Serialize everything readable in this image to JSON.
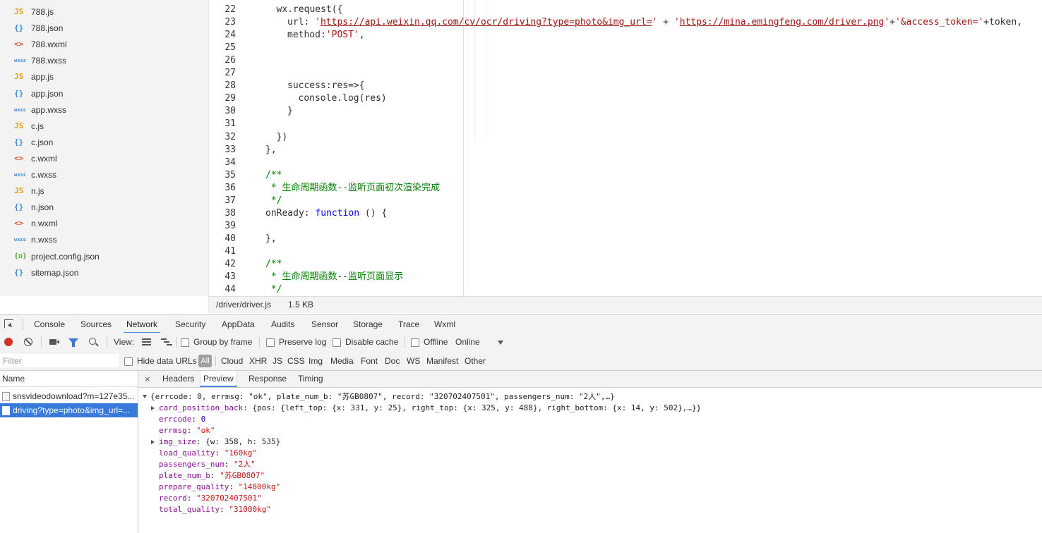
{
  "file_tree": [
    {
      "icon": "js",
      "glyph": "JS",
      "name": "788.js"
    },
    {
      "icon": "json",
      "glyph": "{}",
      "name": "788.json"
    },
    {
      "icon": "wxml",
      "glyph": "<>",
      "name": "788.wxml"
    },
    {
      "icon": "wxss",
      "glyph": "wxss",
      "name": "788.wxss"
    },
    {
      "icon": "js",
      "glyph": "JS",
      "name": "app.js"
    },
    {
      "icon": "json",
      "glyph": "{}",
      "name": "app.json"
    },
    {
      "icon": "wxss",
      "glyph": "wxss",
      "name": "app.wxss"
    },
    {
      "icon": "js",
      "glyph": "JS",
      "name": "c.js"
    },
    {
      "icon": "json",
      "glyph": "{}",
      "name": "c.json"
    },
    {
      "icon": "wxml",
      "glyph": "<>",
      "name": "c.wxml"
    },
    {
      "icon": "wxss",
      "glyph": "wxss",
      "name": "c.wxss"
    },
    {
      "icon": "js",
      "glyph": "JS",
      "name": "n.js"
    },
    {
      "icon": "json",
      "glyph": "{}",
      "name": "n.json"
    },
    {
      "icon": "wxml",
      "glyph": "<>",
      "name": "n.wxml"
    },
    {
      "icon": "wxss",
      "glyph": "wxss",
      "name": "n.wxss"
    },
    {
      "icon": "config",
      "glyph": "{o}",
      "name": "project.config.json"
    },
    {
      "icon": "json",
      "glyph": "{}",
      "name": "sitemap.json"
    }
  ],
  "editor": {
    "lines": [
      {
        "n": "22",
        "indent": 1,
        "parts": [
          [
            "",
            "wx.request({"
          ]
        ]
      },
      {
        "n": "23",
        "indent": 2,
        "parts": [
          [
            "",
            "url: "
          ],
          [
            "str",
            "'"
          ],
          [
            "url",
            "https://api.weixin.qq.com/cv/ocr/driving?type=photo&img_url="
          ],
          [
            "str",
            "'"
          ],
          [
            "",
            " + "
          ],
          [
            "str",
            "'"
          ],
          [
            "url",
            "https://mina.emingfeng.com/driver.png"
          ],
          [
            "str",
            "'"
          ],
          [
            "",
            "+"
          ],
          [
            "str",
            "'&access_token='"
          ],
          [
            "",
            "+token,"
          ]
        ]
      },
      {
        "n": "24",
        "indent": 2,
        "parts": [
          [
            "",
            "method:"
          ],
          [
            "str",
            "'POST'"
          ],
          [
            "",
            ","
          ]
        ]
      },
      {
        "n": "25",
        "indent": 0,
        "parts": []
      },
      {
        "n": "26",
        "indent": 0,
        "parts": []
      },
      {
        "n": "27",
        "indent": 0,
        "parts": []
      },
      {
        "n": "28",
        "indent": 2,
        "parts": [
          [
            "",
            "success:res=>{"
          ]
        ]
      },
      {
        "n": "29",
        "indent": 3,
        "parts": [
          [
            "",
            "console.log(res)"
          ]
        ]
      },
      {
        "n": "30",
        "indent": 2,
        "parts": [
          [
            "",
            "}"
          ]
        ]
      },
      {
        "n": "31",
        "indent": 0,
        "parts": []
      },
      {
        "n": "32",
        "indent": 1,
        "parts": [
          [
            "",
            "})"
          ]
        ]
      },
      {
        "n": "33",
        "indent": 0,
        "parts": [
          [
            "",
            "},"
          ]
        ]
      },
      {
        "n": "34",
        "indent": 0,
        "parts": []
      },
      {
        "n": "35",
        "indent": 0,
        "parts": [
          [
            "cmt",
            "/**"
          ]
        ]
      },
      {
        "n": "36",
        "indent": 0,
        "parts": [
          [
            "cmt",
            " * 生命周期函数--监听页面初次渲染完成"
          ]
        ]
      },
      {
        "n": "37",
        "indent": 0,
        "parts": [
          [
            "cmt",
            " */"
          ]
        ]
      },
      {
        "n": "38",
        "indent": 0,
        "parts": [
          [
            "",
            "onReady: "
          ],
          [
            "kw",
            "function"
          ],
          [
            "",
            " () {"
          ]
        ]
      },
      {
        "n": "39",
        "indent": 0,
        "parts": []
      },
      {
        "n": "40",
        "indent": 0,
        "parts": [
          [
            "",
            "},"
          ]
        ]
      },
      {
        "n": "41",
        "indent": 0,
        "parts": []
      },
      {
        "n": "42",
        "indent": 0,
        "parts": [
          [
            "cmt",
            "/**"
          ]
        ]
      },
      {
        "n": "43",
        "indent": 0,
        "parts": [
          [
            "cmt",
            " * 生命周期函数--监听页面显示"
          ]
        ]
      },
      {
        "n": "44",
        "indent": 0,
        "parts": [
          [
            "cmt",
            " */"
          ]
        ]
      }
    ]
  },
  "status": {
    "path": "/driver/driver.js",
    "size": "1.5 KB"
  },
  "devtools": {
    "tabs": [
      "Console",
      "Sources",
      "Network",
      "Security",
      "AppData",
      "Audits",
      "Sensor",
      "Storage",
      "Trace",
      "Wxml"
    ],
    "active_tab": "Network"
  },
  "net_toolbar": {
    "view_label": "View:",
    "group_by_frame": "Group by frame",
    "preserve_log": "Preserve log",
    "disable_cache": "Disable cache",
    "offline": "Offline",
    "throttle": "Online"
  },
  "filter_bar": {
    "placeholder": "Filter",
    "hide_data_urls": "Hide data URLs",
    "all": "All",
    "types": [
      "Cloud",
      "XHR",
      "JS",
      "CSS",
      "Img",
      "Media",
      "Font",
      "Doc",
      "WS",
      "Manifest",
      "Other"
    ]
  },
  "requests": {
    "header": "Name",
    "rows": [
      {
        "name": "snsvideodownload?m=127e35...",
        "selected": false
      },
      {
        "name": "driving?type=photo&img_url=...",
        "selected": true
      }
    ]
  },
  "detail": {
    "close": "×",
    "tabs": [
      "Headers",
      "Preview",
      "Response",
      "Timing"
    ],
    "active_tab": "Preview",
    "preview": [
      {
        "toggle": "down",
        "indent": 0,
        "parts": [
          [
            "",
            "{errcode: 0, errmsg: \"ok\", plate_num_b: \"苏GB0807\", record: \"320702407501\", passengers_num: \"2人\",…}"
          ]
        ]
      },
      {
        "toggle": "right",
        "indent": 1,
        "parts": [
          [
            "pk",
            "card_position_back"
          ],
          [
            "",
            ": {pos: {left_top: {x: 331, y: 25}, right_top: {x: 325, y: 488}, right_bottom: {x: 14, y: 502},…}}"
          ]
        ]
      },
      {
        "toggle": "",
        "indent": 1,
        "parts": [
          [
            "pk",
            "errcode"
          ],
          [
            "",
            ": "
          ],
          [
            "pn",
            "0"
          ]
        ]
      },
      {
        "toggle": "",
        "indent": 1,
        "parts": [
          [
            "pk",
            "errmsg"
          ],
          [
            "",
            ": "
          ],
          [
            "ps",
            "\"ok\""
          ]
        ]
      },
      {
        "toggle": "right",
        "indent": 1,
        "parts": [
          [
            "pk",
            "img_size"
          ],
          [
            "",
            ": {w: 358, h: 535}"
          ]
        ]
      },
      {
        "toggle": "",
        "indent": 1,
        "parts": [
          [
            "pk",
            "load_quality"
          ],
          [
            "",
            ": "
          ],
          [
            "ps",
            "\"160kg\""
          ]
        ]
      },
      {
        "toggle": "",
        "indent": 1,
        "parts": [
          [
            "pk",
            "passengers_num"
          ],
          [
            "",
            ": "
          ],
          [
            "ps",
            "\"2人\""
          ]
        ]
      },
      {
        "toggle": "",
        "indent": 1,
        "parts": [
          [
            "pk",
            "plate_num_b"
          ],
          [
            "",
            ": "
          ],
          [
            "ps",
            "\"苏GB0807\""
          ]
        ]
      },
      {
        "toggle": "",
        "indent": 1,
        "parts": [
          [
            "pk",
            "prepare_quality"
          ],
          [
            "",
            ": "
          ],
          [
            "ps",
            "\"14800kg\""
          ]
        ]
      },
      {
        "toggle": "",
        "indent": 1,
        "parts": [
          [
            "pk",
            "record"
          ],
          [
            "",
            ": "
          ],
          [
            "ps",
            "\"320702407501\""
          ]
        ]
      },
      {
        "toggle": "",
        "indent": 1,
        "parts": [
          [
            "pk",
            "total_quality"
          ],
          [
            "",
            ": "
          ],
          [
            "ps",
            "\"31000kg\""
          ]
        ]
      }
    ]
  },
  "colors": {
    "accent": "#4a8ad6",
    "selected_row": "#3879d9",
    "record_button": "#d93025",
    "filter_icon": "#3879d9"
  }
}
